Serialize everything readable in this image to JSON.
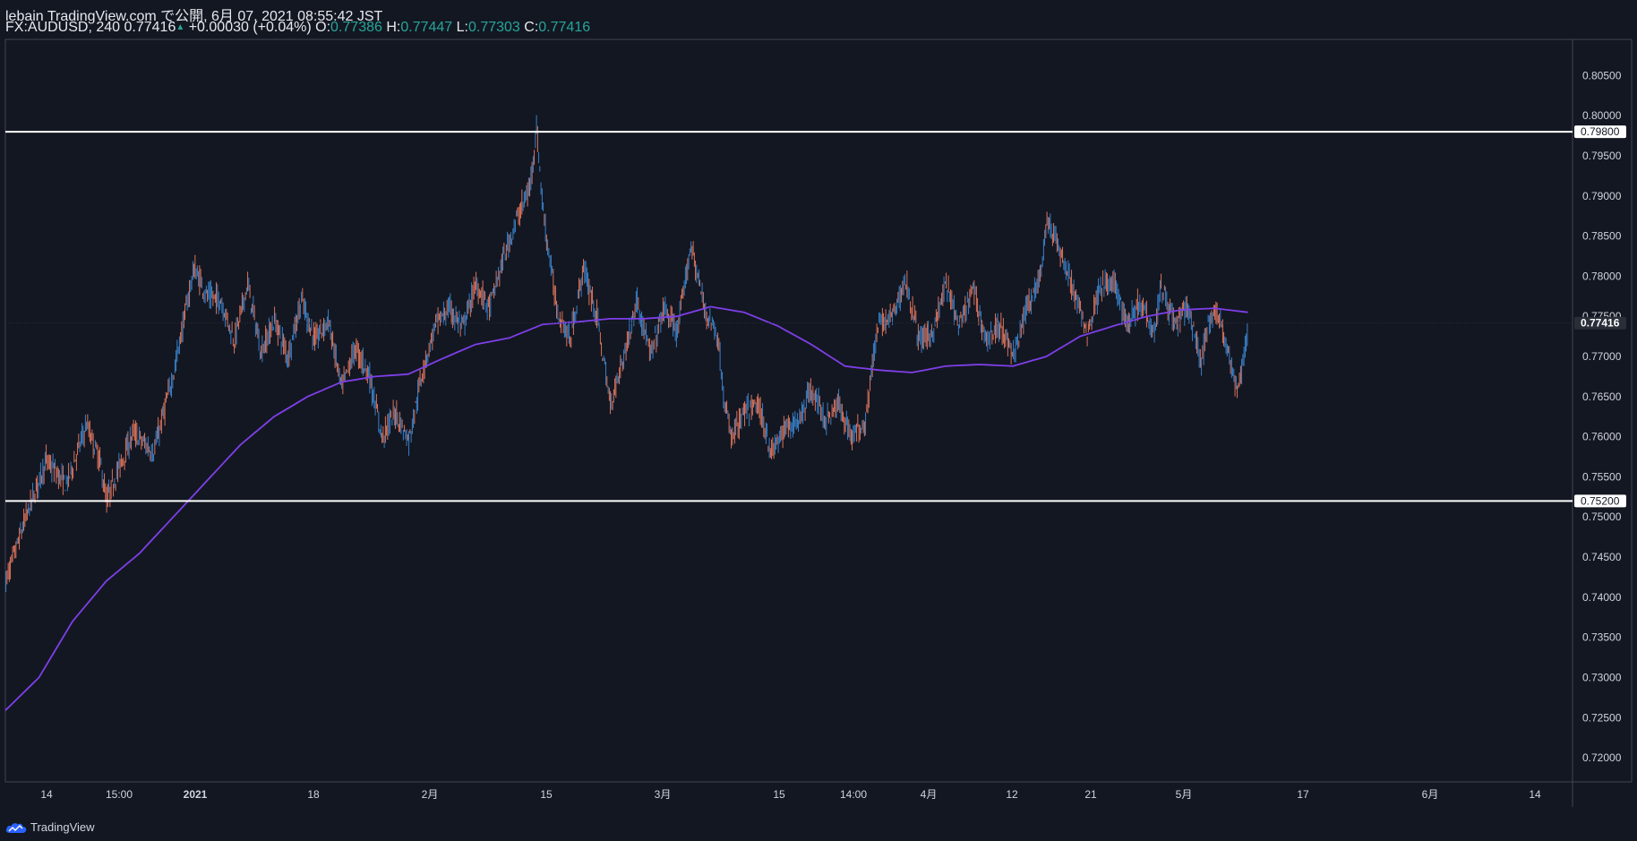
{
  "header": {
    "line1": "lebain TradingView.com で公開, 6月 07, 2021 08:55:42 JST",
    "symbol": "FX:AUDUSD, 240",
    "last": "0.77416",
    "change": "+0.00030 (+0.04%)",
    "open_label": "O:",
    "open": "0.77386",
    "high_label": "H:",
    "high": "0.77447",
    "low_label": "L:",
    "low": "0.77303",
    "close_label": "C:",
    "close": "0.77416"
  },
  "brand": {
    "label": "TradingView",
    "icon": "tradingview-cloud-icon"
  },
  "chart_data": {
    "type": "candlestick",
    "title": "FX:AUDUSD, 240",
    "xlabel": "",
    "ylabel": "",
    "ylim": [
      0.717,
      0.8095
    ],
    "grid": false,
    "y_ticks": [
      "0.72000",
      "0.72500",
      "0.73000",
      "0.73500",
      "0.74000",
      "0.74500",
      "0.75000",
      "0.75500",
      "0.76000",
      "0.76500",
      "0.77000",
      "0.77500",
      "0.78000",
      "0.78500",
      "0.79000",
      "0.79500",
      "0.80000",
      "0.80500"
    ],
    "x_ticks": [
      "14",
      "15:00",
      "2021",
      "18",
      "2月",
      "15",
      "3月",
      "15",
      "14:00",
      "4月",
      "12",
      "21",
      "5月",
      "17",
      "6月",
      "14"
    ],
    "x_tick_bold": [
      false,
      false,
      true,
      false,
      false,
      false,
      false,
      false,
      false,
      false,
      false,
      false,
      false,
      false,
      false,
      false
    ],
    "price_key": [
      [
        0,
        0.742
      ],
      [
        3,
        0.75
      ],
      [
        6,
        0.757
      ],
      [
        9,
        0.754
      ],
      [
        12,
        0.7615
      ],
      [
        14,
        0.757
      ],
      [
        15,
        0.752
      ],
      [
        17,
        0.7565
      ],
      [
        19,
        0.7605
      ],
      [
        22,
        0.758
      ],
      [
        25,
        0.768
      ],
      [
        28,
        0.781
      ],
      [
        30,
        0.7775
      ],
      [
        32,
        0.777
      ],
      [
        34,
        0.772
      ],
      [
        36,
        0.779
      ],
      [
        38,
        0.7705
      ],
      [
        40,
        0.7745
      ],
      [
        42,
        0.77
      ],
      [
        44,
        0.777
      ],
      [
        46,
        0.772
      ],
      [
        48,
        0.7745
      ],
      [
        50,
        0.766
      ],
      [
        52,
        0.771
      ],
      [
        54,
        0.768
      ],
      [
        56,
        0.76
      ],
      [
        58,
        0.763
      ],
      [
        60,
        0.7595
      ],
      [
        62,
        0.768
      ],
      [
        64,
        0.774
      ],
      [
        66,
        0.776
      ],
      [
        68,
        0.7735
      ],
      [
        70,
        0.779
      ],
      [
        72,
        0.776
      ],
      [
        74,
        0.782
      ],
      [
        76,
        0.787
      ],
      [
        78,
        0.791
      ],
      [
        79,
        0.7985
      ],
      [
        80,
        0.788
      ],
      [
        82,
        0.776
      ],
      [
        84,
        0.772
      ],
      [
        86,
        0.781
      ],
      [
        88,
        0.775
      ],
      [
        90,
        0.764
      ],
      [
        92,
        0.77
      ],
      [
        94,
        0.777
      ],
      [
        96,
        0.77
      ],
      [
        98,
        0.776
      ],
      [
        100,
        0.773
      ],
      [
        102,
        0.784
      ],
      [
        104,
        0.776
      ],
      [
        106,
        0.7725
      ],
      [
        107,
        0.764
      ],
      [
        108,
        0.76
      ],
      [
        110,
        0.763
      ],
      [
        112,
        0.764
      ],
      [
        114,
        0.758
      ],
      [
        116,
        0.761
      ],
      [
        118,
        0.762
      ],
      [
        120,
        0.766
      ],
      [
        122,
        0.762
      ],
      [
        124,
        0.764
      ],
      [
        126,
        0.76
      ],
      [
        128,
        0.762
      ],
      [
        129,
        0.769
      ],
      [
        130,
        0.774
      ],
      [
        132,
        0.775
      ],
      [
        134,
        0.7795
      ],
      [
        136,
        0.772
      ],
      [
        138,
        0.773
      ],
      [
        140,
        0.779
      ],
      [
        142,
        0.7735
      ],
      [
        144,
        0.7785
      ],
      [
        146,
        0.772
      ],
      [
        148,
        0.774
      ],
      [
        150,
        0.77
      ],
      [
        152,
        0.776
      ],
      [
        154,
        0.78
      ],
      [
        155,
        0.787
      ],
      [
        157,
        0.783
      ],
      [
        159,
        0.778
      ],
      [
        161,
        0.773
      ],
      [
        163,
        0.779
      ],
      [
        165,
        0.779
      ],
      [
        167,
        0.774
      ],
      [
        169,
        0.777
      ],
      [
        171,
        0.773
      ],
      [
        172,
        0.779
      ],
      [
        174,
        0.774
      ],
      [
        176,
        0.776
      ],
      [
        178,
        0.769
      ],
      [
        179,
        0.774
      ],
      [
        180,
        0.776
      ],
      [
        182,
        0.771
      ],
      [
        183,
        0.766
      ],
      [
        184,
        0.768
      ],
      [
        185,
        0.7741
      ]
    ],
    "ma_key": [
      [
        0,
        0.7259
      ],
      [
        5,
        0.73
      ],
      [
        10,
        0.737
      ],
      [
        15,
        0.742
      ],
      [
        20,
        0.7455
      ],
      [
        25,
        0.75
      ],
      [
        30,
        0.7545
      ],
      [
        35,
        0.759
      ],
      [
        40,
        0.7625
      ],
      [
        45,
        0.765
      ],
      [
        50,
        0.7668
      ],
      [
        55,
        0.7675
      ],
      [
        60,
        0.7678
      ],
      [
        65,
        0.7697
      ],
      [
        70,
        0.7715
      ],
      [
        75,
        0.7723
      ],
      [
        80,
        0.774
      ],
      [
        85,
        0.7743
      ],
      [
        90,
        0.7747
      ],
      [
        95,
        0.7747
      ],
      [
        100,
        0.775
      ],
      [
        105,
        0.7762
      ],
      [
        110,
        0.7755
      ],
      [
        115,
        0.7738
      ],
      [
        120,
        0.7715
      ],
      [
        125,
        0.7688
      ],
      [
        130,
        0.7683
      ],
      [
        135,
        0.768
      ],
      [
        140,
        0.7688
      ],
      [
        145,
        0.769
      ],
      [
        150,
        0.7688
      ],
      [
        155,
        0.77
      ],
      [
        160,
        0.7725
      ],
      [
        165,
        0.7738
      ],
      [
        170,
        0.775
      ],
      [
        175,
        0.7758
      ],
      [
        180,
        0.776
      ],
      [
        185,
        0.7755
      ]
    ],
    "horizontal_lines": [
      {
        "value": 0.798,
        "label": "0.79800"
      },
      {
        "value": 0.752,
        "label": "0.75200"
      }
    ],
    "last_price": {
      "value": 0.77416,
      "label": "0.77416"
    },
    "colors": {
      "background": "#131722",
      "up": "#3d8bd9",
      "down": "#ef7d62",
      "ma": "#7e3fe8",
      "level_line": "#ffffff",
      "text": "#d1d4dc",
      "axis": "#434651",
      "teal": "#26a69a"
    }
  }
}
